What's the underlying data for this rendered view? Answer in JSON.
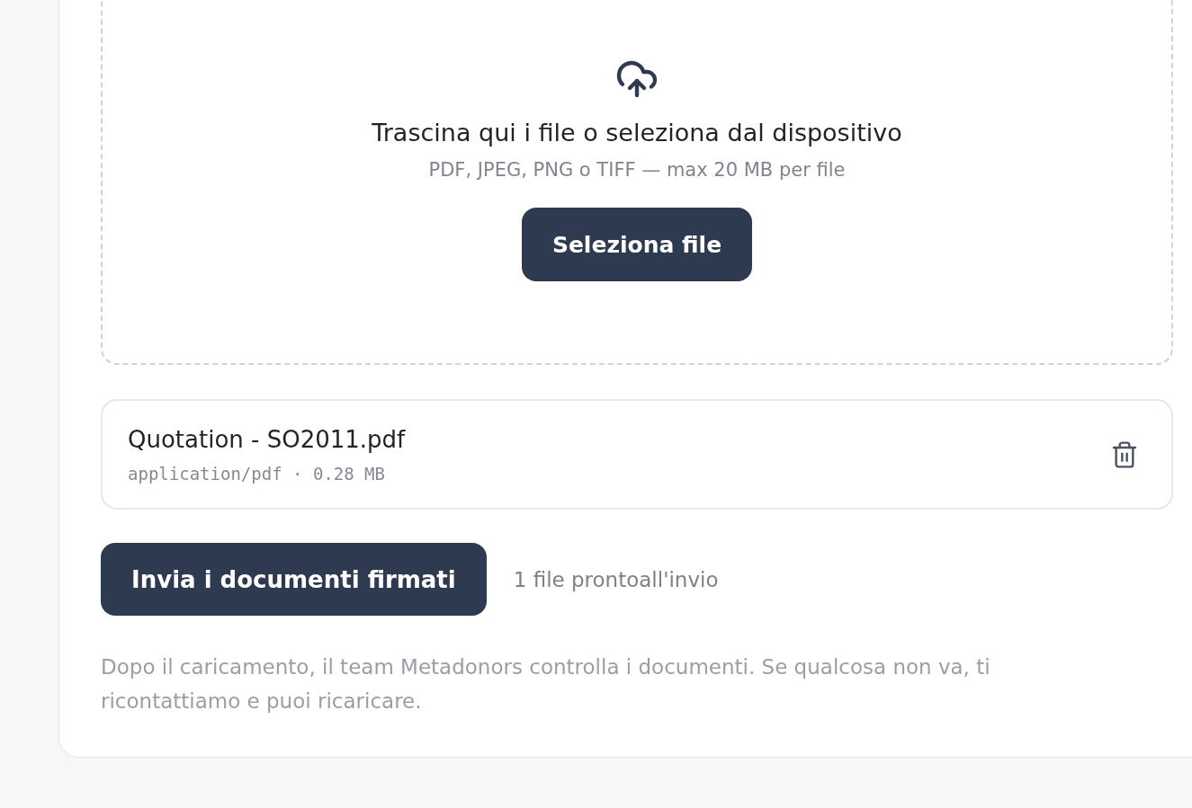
{
  "dropzone": {
    "title": "Trascina qui i file o seleziona dal dispositivo",
    "hint": "PDF, JPEG, PNG o TIFF — max 20 MB per file",
    "button": "Seleziona file"
  },
  "files": [
    {
      "name": "Quotation - SO2011.pdf",
      "meta": "application/pdf · 0.28 MB"
    }
  ],
  "submit": {
    "button": "Invia i documenti firmati",
    "status": "1 file prontoall'invio"
  },
  "note": "Dopo il caricamento, il team Metadonors controlla i documenti. Se qualcosa non va, ti ricontattiamo e puoi ricaricare."
}
